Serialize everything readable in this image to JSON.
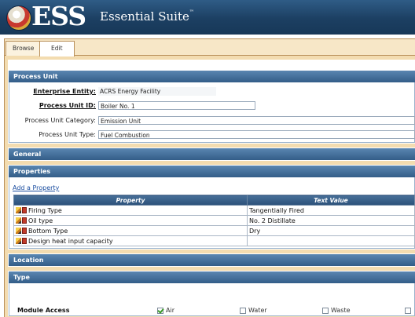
{
  "app": {
    "logo_text": "ESS",
    "subtitle": "Essential Suite",
    "trademark": "™"
  },
  "tabs": [
    {
      "label": "Browse"
    },
    {
      "label": "Edit"
    }
  ],
  "sections": {
    "process_unit": "Process Unit",
    "general": "General",
    "properties": "Properties",
    "location": "Location",
    "type": "Type"
  },
  "process_unit": {
    "enterprise_entity": {
      "label": "Enterprise Entity:",
      "value": "ACRS Energy Facility"
    },
    "process_unit_id": {
      "label": "Process Unit ID:",
      "value": "Boiler No. 1"
    },
    "category": {
      "label": "Process Unit Category:",
      "value": "Emission Unit"
    },
    "unit_type": {
      "label": "Process Unit Type:",
      "value": "Fuel Combustion"
    }
  },
  "properties": {
    "add_link": "Add a Property",
    "headers": {
      "property": "Property",
      "text_value": "Text Value"
    },
    "rows": [
      {
        "property": "Firing Type",
        "value": "Tangentially Fired"
      },
      {
        "property": "Oil type",
        "value": "No. 2 Distillate"
      },
      {
        "property": "Bottom Type",
        "value": "Dry"
      },
      {
        "property": "Design heat input capacity",
        "value": ""
      }
    ]
  },
  "module_access": {
    "label": "Module Access",
    "options": [
      {
        "label": "Air",
        "checked": true
      },
      {
        "label": "Water",
        "checked": false
      },
      {
        "label": "Waste",
        "checked": false
      },
      {
        "label": "",
        "checked": false
      }
    ]
  },
  "colors": {
    "header_blue": "#335d88",
    "frame_tan": "#f3dcb0",
    "link": "#1a4da0"
  }
}
